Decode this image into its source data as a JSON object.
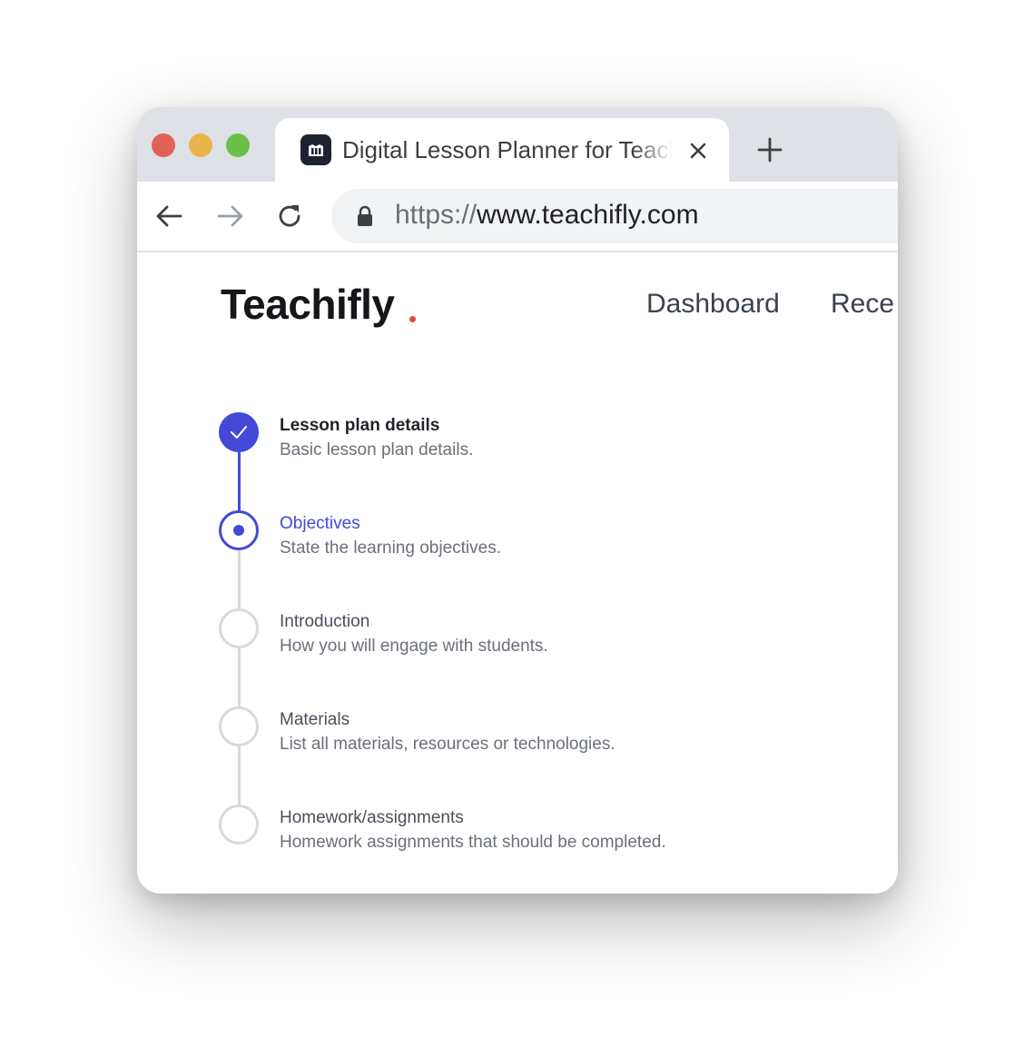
{
  "browser": {
    "tab_title": "Digital Lesson Planner for Teachers",
    "url_scheme": "https://",
    "url_host": "www.teachifly.com"
  },
  "site": {
    "logo": "Teachifly",
    "nav": [
      "Dashboard",
      "Rece"
    ]
  },
  "steps": [
    {
      "title": "Lesson plan details",
      "description": "Basic lesson plan details.",
      "status": "complete"
    },
    {
      "title": "Objectives",
      "description": "State the learning objectives.",
      "status": "current"
    },
    {
      "title": "Introduction",
      "description": "How you will engage with students.",
      "status": "upcoming"
    },
    {
      "title": "Materials",
      "description": "List all materials, resources or technologies.",
      "status": "upcoming"
    },
    {
      "title": "Homework/assignments",
      "description": "Homework assignments that should be completed.",
      "status": "upcoming"
    }
  ],
  "colors": {
    "accent": "#4349d6",
    "inactive_circle": "#d7d9dd",
    "logo_dot": "#e14b3b"
  }
}
